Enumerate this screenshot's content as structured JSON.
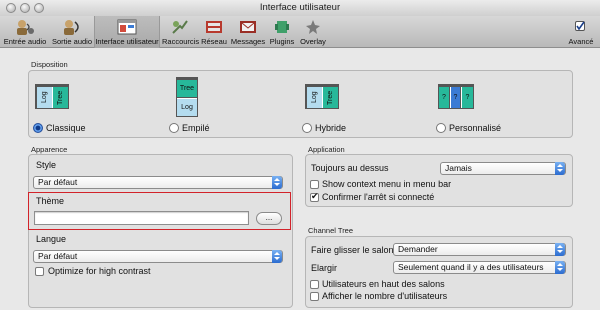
{
  "window": {
    "title": "Interface utilisateur"
  },
  "toolbar": {
    "items": [
      {
        "label": "Entrée audio",
        "icon": "audio-input-icon"
      },
      {
        "label": "Sortie audio",
        "icon": "audio-output-icon"
      },
      {
        "label": "Interface utilisateur",
        "icon": "user-interface-icon",
        "active": true
      },
      {
        "label": "Raccourcis",
        "icon": "shortcuts-icon"
      },
      {
        "label": "Réseau",
        "icon": "network-icon"
      },
      {
        "label": "Messages",
        "icon": "messages-icon"
      },
      {
        "label": "Plugins",
        "icon": "plugins-icon"
      },
      {
        "label": "Overlay",
        "icon": "overlay-icon"
      }
    ],
    "advanced": {
      "label": "Avancé",
      "checked": true
    }
  },
  "disposition": {
    "title": "Disposition",
    "options": [
      {
        "label": "Classique",
        "selected": true,
        "panes": [
          "Log",
          "Tree"
        ]
      },
      {
        "label": "Empilé",
        "selected": false,
        "panes": [
          "Tree",
          "Log"
        ]
      },
      {
        "label": "Hybride",
        "selected": false,
        "panes": [
          "Log",
          "Tree"
        ]
      },
      {
        "label": "Personnalisé",
        "selected": false,
        "panes": [
          "?",
          "?",
          "?"
        ]
      }
    ]
  },
  "apparence": {
    "title": "Apparence",
    "style_label": "Style",
    "style_value": "Par défaut",
    "theme_label": "Thème",
    "theme_value": "",
    "browse_label": "...",
    "langue_label": "Langue",
    "langue_value": "Par défaut",
    "high_contrast": {
      "label": "Optimize for high contrast",
      "checked": false
    }
  },
  "application": {
    "title": "Application",
    "top_label": "Toujours au dessus",
    "top_value": "Jamais",
    "context_menu": {
      "label": "Show context menu in menu bar",
      "checked": false
    },
    "confirm_quit": {
      "label": "Confirmer l'arrêt si connecté",
      "checked": true
    }
  },
  "channel_tree": {
    "title": "Channel Tree",
    "drag_label": "Faire glisser le salon",
    "drag_value": "Demander",
    "expand_label": "Elargir",
    "expand_value": "Seulement quand il y a des utilisateurs",
    "users_top": {
      "label": "Utilisateurs en haut des salons",
      "checked": false
    },
    "show_count": {
      "label": "Afficher le nombre d'utilisateurs",
      "checked": false
    }
  },
  "colors": {
    "highlight": "#d2232a",
    "accent": "#2f6fd2",
    "pane_teal": "#27b89a"
  }
}
